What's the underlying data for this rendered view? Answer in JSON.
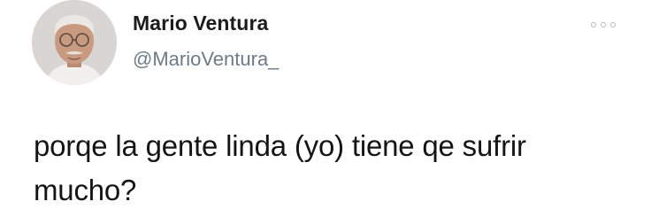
{
  "tweet": {
    "display_name": "Mario Ventura",
    "handle": "@MarioVentura_",
    "text": "porqe la gente linda (yo) tiene qe sufrir mucho?",
    "more_icon": "more-horizontal-icon"
  }
}
